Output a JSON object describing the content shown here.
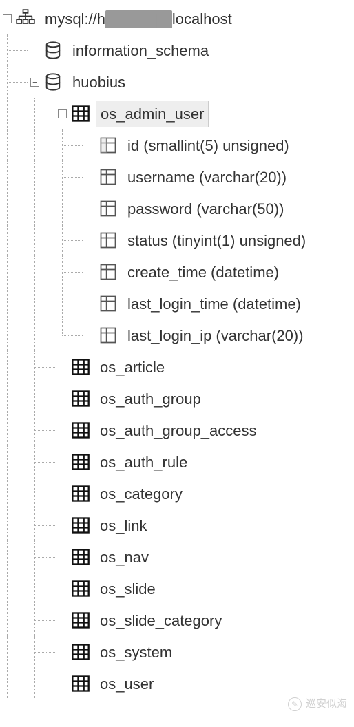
{
  "connection": {
    "prefix": "mysql://h",
    "redacted": "▆▆ ▆▆ ▆",
    "suffix": "localhost"
  },
  "databases": {
    "items": [
      {
        "name": "information_schema",
        "expanded": false
      },
      {
        "name": "huobius",
        "expanded": true
      }
    ]
  },
  "huobius": {
    "tables": [
      {
        "name": "os_admin_user",
        "expanded": true,
        "selected": true
      },
      {
        "name": "os_article"
      },
      {
        "name": "os_auth_group"
      },
      {
        "name": "os_auth_group_access"
      },
      {
        "name": "os_auth_rule"
      },
      {
        "name": "os_category"
      },
      {
        "name": "os_link"
      },
      {
        "name": "os_nav"
      },
      {
        "name": "os_slide"
      },
      {
        "name": "os_slide_category"
      },
      {
        "name": "os_system"
      },
      {
        "name": "os_user"
      }
    ]
  },
  "os_admin_user": {
    "columns": [
      {
        "label": "id (smallint(5) unsigned)",
        "pk": true
      },
      {
        "label": "username (varchar(20))"
      },
      {
        "label": "password (varchar(50))"
      },
      {
        "label": "status (tinyint(1) unsigned)"
      },
      {
        "label": "create_time (datetime)"
      },
      {
        "label": "last_login_time (datetime)"
      },
      {
        "label": "last_login_ip (varchar(20))"
      }
    ]
  },
  "toggles": {
    "minus": "−",
    "plus": "+"
  },
  "watermark": {
    "text": "巡安似海"
  }
}
